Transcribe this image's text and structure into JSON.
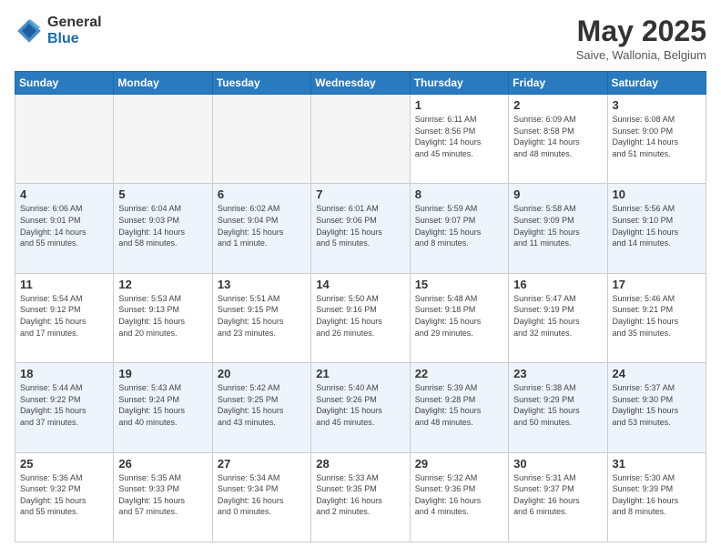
{
  "header": {
    "logo_general": "General",
    "logo_blue": "Blue",
    "month_title": "May 2025",
    "location": "Saive, Wallonia, Belgium"
  },
  "days_of_week": [
    "Sunday",
    "Monday",
    "Tuesday",
    "Wednesday",
    "Thursday",
    "Friday",
    "Saturday"
  ],
  "weeks": [
    [
      {
        "day": "",
        "info": ""
      },
      {
        "day": "",
        "info": ""
      },
      {
        "day": "",
        "info": ""
      },
      {
        "day": "",
        "info": ""
      },
      {
        "day": "1",
        "info": "Sunrise: 6:11 AM\nSunset: 8:56 PM\nDaylight: 14 hours\nand 45 minutes."
      },
      {
        "day": "2",
        "info": "Sunrise: 6:09 AM\nSunset: 8:58 PM\nDaylight: 14 hours\nand 48 minutes."
      },
      {
        "day": "3",
        "info": "Sunrise: 6:08 AM\nSunset: 9:00 PM\nDaylight: 14 hours\nand 51 minutes."
      }
    ],
    [
      {
        "day": "4",
        "info": "Sunrise: 6:06 AM\nSunset: 9:01 PM\nDaylight: 14 hours\nand 55 minutes."
      },
      {
        "day": "5",
        "info": "Sunrise: 6:04 AM\nSunset: 9:03 PM\nDaylight: 14 hours\nand 58 minutes."
      },
      {
        "day": "6",
        "info": "Sunrise: 6:02 AM\nSunset: 9:04 PM\nDaylight: 15 hours\nand 1 minute."
      },
      {
        "day": "7",
        "info": "Sunrise: 6:01 AM\nSunset: 9:06 PM\nDaylight: 15 hours\nand 5 minutes."
      },
      {
        "day": "8",
        "info": "Sunrise: 5:59 AM\nSunset: 9:07 PM\nDaylight: 15 hours\nand 8 minutes."
      },
      {
        "day": "9",
        "info": "Sunrise: 5:58 AM\nSunset: 9:09 PM\nDaylight: 15 hours\nand 11 minutes."
      },
      {
        "day": "10",
        "info": "Sunrise: 5:56 AM\nSunset: 9:10 PM\nDaylight: 15 hours\nand 14 minutes."
      }
    ],
    [
      {
        "day": "11",
        "info": "Sunrise: 5:54 AM\nSunset: 9:12 PM\nDaylight: 15 hours\nand 17 minutes."
      },
      {
        "day": "12",
        "info": "Sunrise: 5:53 AM\nSunset: 9:13 PM\nDaylight: 15 hours\nand 20 minutes."
      },
      {
        "day": "13",
        "info": "Sunrise: 5:51 AM\nSunset: 9:15 PM\nDaylight: 15 hours\nand 23 minutes."
      },
      {
        "day": "14",
        "info": "Sunrise: 5:50 AM\nSunset: 9:16 PM\nDaylight: 15 hours\nand 26 minutes."
      },
      {
        "day": "15",
        "info": "Sunrise: 5:48 AM\nSunset: 9:18 PM\nDaylight: 15 hours\nand 29 minutes."
      },
      {
        "day": "16",
        "info": "Sunrise: 5:47 AM\nSunset: 9:19 PM\nDaylight: 15 hours\nand 32 minutes."
      },
      {
        "day": "17",
        "info": "Sunrise: 5:46 AM\nSunset: 9:21 PM\nDaylight: 15 hours\nand 35 minutes."
      }
    ],
    [
      {
        "day": "18",
        "info": "Sunrise: 5:44 AM\nSunset: 9:22 PM\nDaylight: 15 hours\nand 37 minutes."
      },
      {
        "day": "19",
        "info": "Sunrise: 5:43 AM\nSunset: 9:24 PM\nDaylight: 15 hours\nand 40 minutes."
      },
      {
        "day": "20",
        "info": "Sunrise: 5:42 AM\nSunset: 9:25 PM\nDaylight: 15 hours\nand 43 minutes."
      },
      {
        "day": "21",
        "info": "Sunrise: 5:40 AM\nSunset: 9:26 PM\nDaylight: 15 hours\nand 45 minutes."
      },
      {
        "day": "22",
        "info": "Sunrise: 5:39 AM\nSunset: 9:28 PM\nDaylight: 15 hours\nand 48 minutes."
      },
      {
        "day": "23",
        "info": "Sunrise: 5:38 AM\nSunset: 9:29 PM\nDaylight: 15 hours\nand 50 minutes."
      },
      {
        "day": "24",
        "info": "Sunrise: 5:37 AM\nSunset: 9:30 PM\nDaylight: 15 hours\nand 53 minutes."
      }
    ],
    [
      {
        "day": "25",
        "info": "Sunrise: 5:36 AM\nSunset: 9:32 PM\nDaylight: 15 hours\nand 55 minutes."
      },
      {
        "day": "26",
        "info": "Sunrise: 5:35 AM\nSunset: 9:33 PM\nDaylight: 15 hours\nand 57 minutes."
      },
      {
        "day": "27",
        "info": "Sunrise: 5:34 AM\nSunset: 9:34 PM\nDaylight: 16 hours\nand 0 minutes."
      },
      {
        "day": "28",
        "info": "Sunrise: 5:33 AM\nSunset: 9:35 PM\nDaylight: 16 hours\nand 2 minutes."
      },
      {
        "day": "29",
        "info": "Sunrise: 5:32 AM\nSunset: 9:36 PM\nDaylight: 16 hours\nand 4 minutes."
      },
      {
        "day": "30",
        "info": "Sunrise: 5:31 AM\nSunset: 9:37 PM\nDaylight: 16 hours\nand 6 minutes."
      },
      {
        "day": "31",
        "info": "Sunrise: 5:30 AM\nSunset: 9:39 PM\nDaylight: 16 hours\nand 8 minutes."
      }
    ]
  ]
}
